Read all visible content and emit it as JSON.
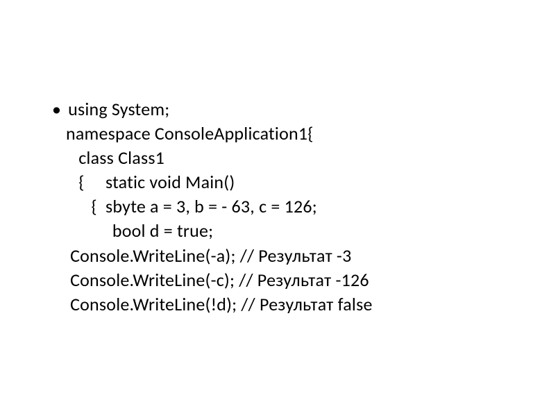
{
  "code": {
    "lines": [
      "using System;",
      "namespace ConsoleApplication1{",
      "   class Class1",
      "   {     static void Main()",
      "      {  sbyte a = 3, b = - 63, c = 126;",
      "           bool d = true;",
      " Console.WriteLine(-a); // Результат -3",
      " Console.WriteLine(-c); // Результат -126",
      " Console.WriteLine(!d); // Результат false"
    ],
    "bullet": "•"
  }
}
